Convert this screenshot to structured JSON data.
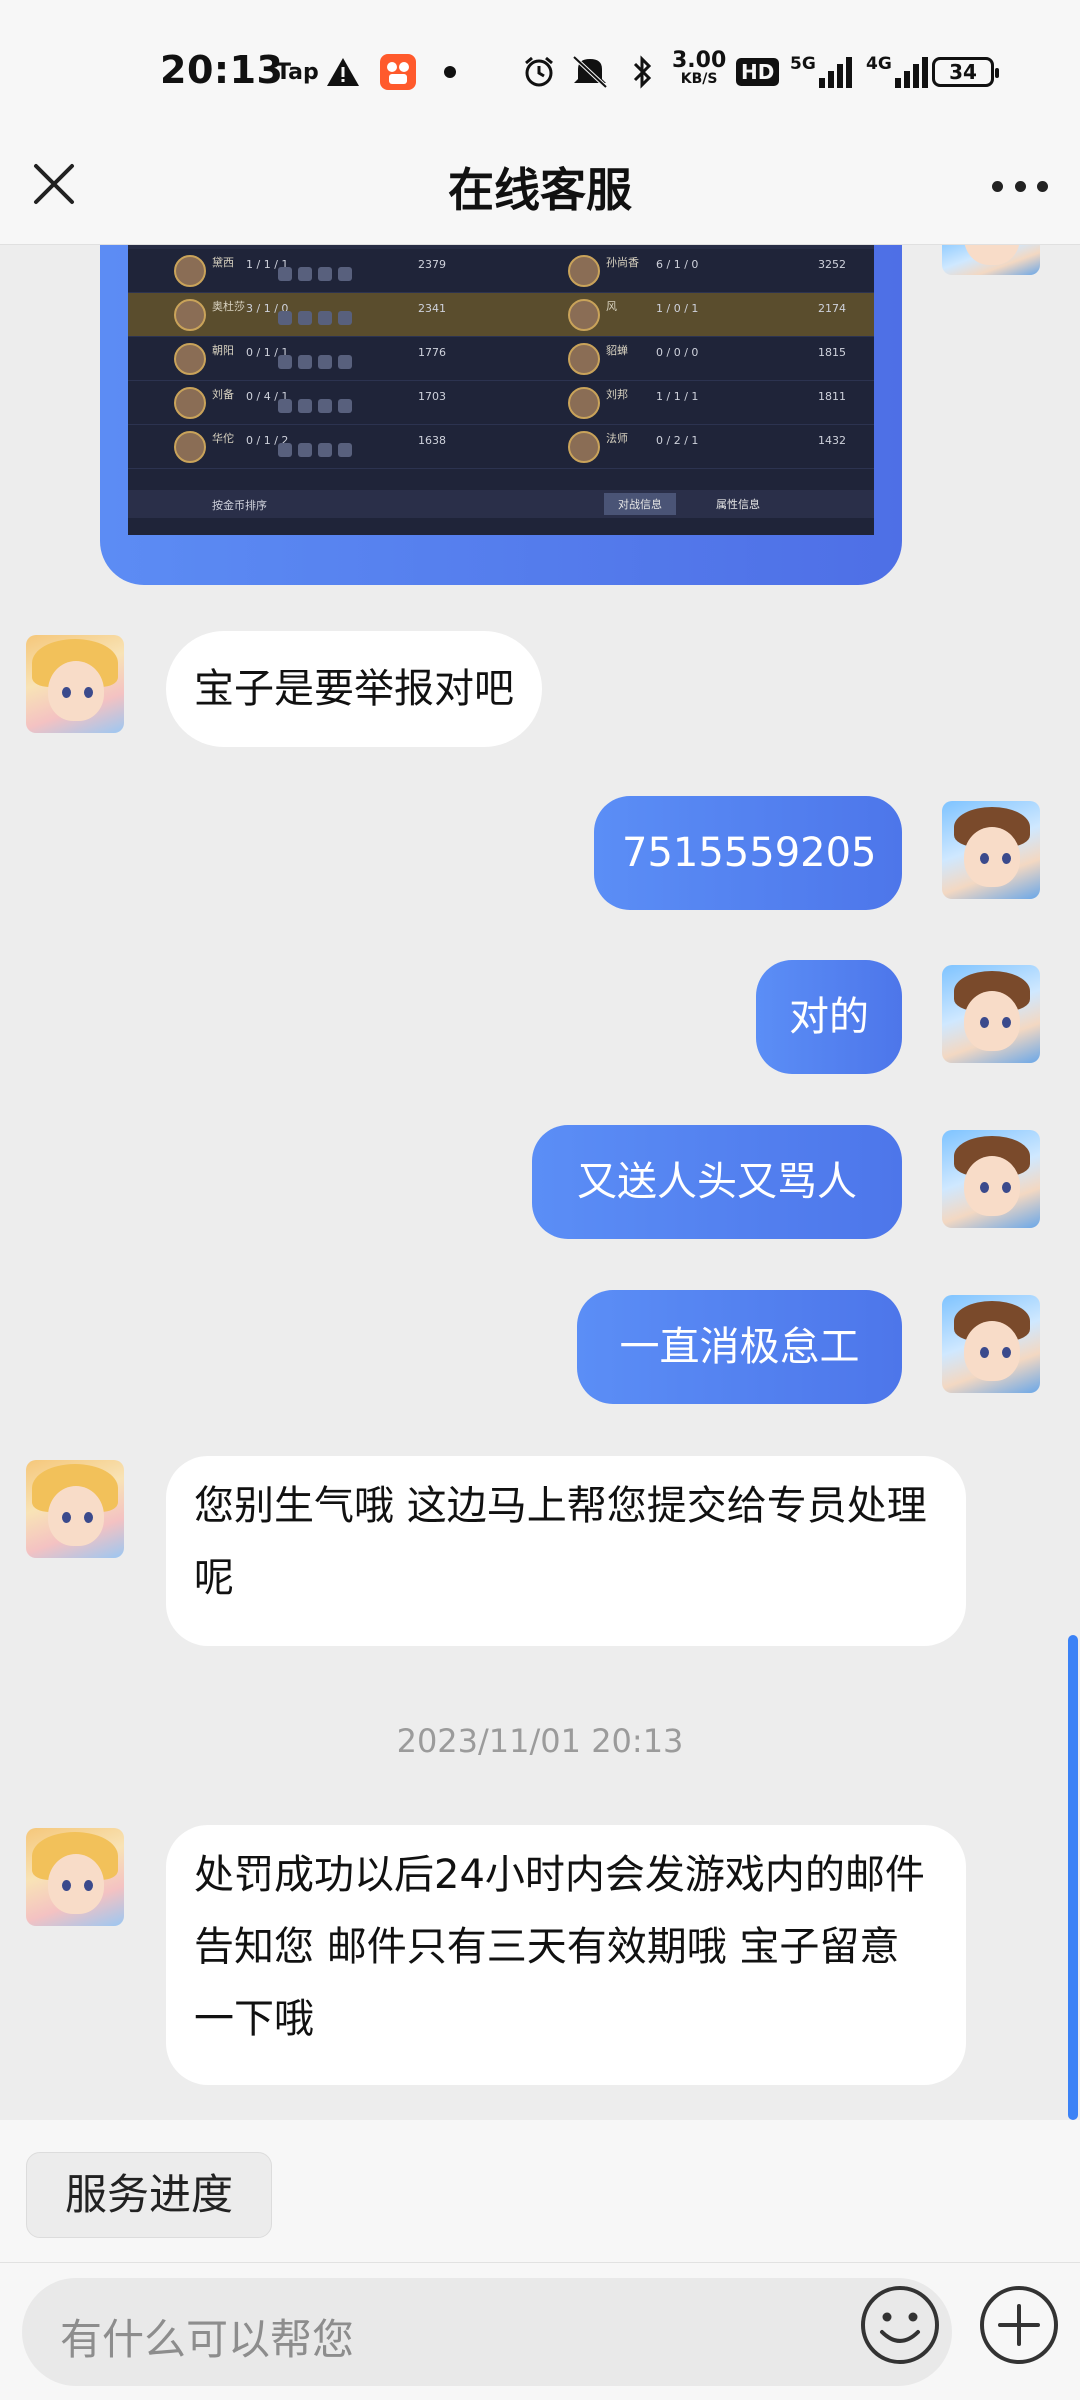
{
  "status_bar": {
    "time": "20:13",
    "tap_label": "Tap",
    "network_speed": "3.00",
    "network_unit": "KB/S",
    "hd_label": "HD",
    "signal_5g": "5G",
    "signal_4g": "4G",
    "battery": "34"
  },
  "header": {
    "title": "在线客服"
  },
  "screenshot_card": {
    "players_left": [
      {
        "name": "黛西",
        "kda": "1 / 1 / 1",
        "gold": "2379"
      },
      {
        "name": "奥杜莎",
        "kda": "3 / 1 / 0",
        "gold": "2341"
      },
      {
        "name": "朝阳",
        "kda": "0 / 1 / 1",
        "gold": "1776"
      },
      {
        "name": "刘备",
        "kda": "0 / 4 / 1",
        "gold": "1703"
      },
      {
        "name": "华佗",
        "kda": "0 / 1 / 2",
        "gold": "1638"
      }
    ],
    "players_right": [
      {
        "name": "孙尚香",
        "kda": "6 / 1 / 0",
        "gold": "3252"
      },
      {
        "name": "风",
        "kda": "1 / 0 / 1",
        "gold": "2174"
      },
      {
        "name": "貂蝉",
        "kda": "0 / 0 / 0",
        "gold": "1815"
      },
      {
        "name": "刘邦",
        "kda": "1 / 1 / 1",
        "gold": "1811"
      },
      {
        "name": "法师",
        "kda": "0 / 2 / 1",
        "gold": "1432"
      }
    ],
    "sort_label": "按金币排序",
    "tab_battle": "对战信息",
    "tab_attr": "属性信息"
  },
  "messages": [
    {
      "from": "agent",
      "text": "宝子是要举报对吧"
    },
    {
      "from": "user",
      "text": "7515559205"
    },
    {
      "from": "user",
      "text": "对的"
    },
    {
      "from": "user",
      "text": "又送人头又骂人"
    },
    {
      "from": "user",
      "text": "一直消极怠工"
    },
    {
      "from": "agent",
      "text": "您别生气哦 这边马上帮您提交给专员处理呢"
    },
    {
      "from": "agent",
      "text": "处罚成功以后24小时内会发游戏内的邮件告知您 邮件只有三天有效期哦 宝子留意一下哦"
    }
  ],
  "timestamp": "2023/11/01 20:13",
  "bottom": {
    "service_progress": "服务进度",
    "input_placeholder": "有什么可以帮您"
  },
  "colors": {
    "accent_blue": "#4d76ea",
    "scrollbar": "#3b82f6"
  }
}
